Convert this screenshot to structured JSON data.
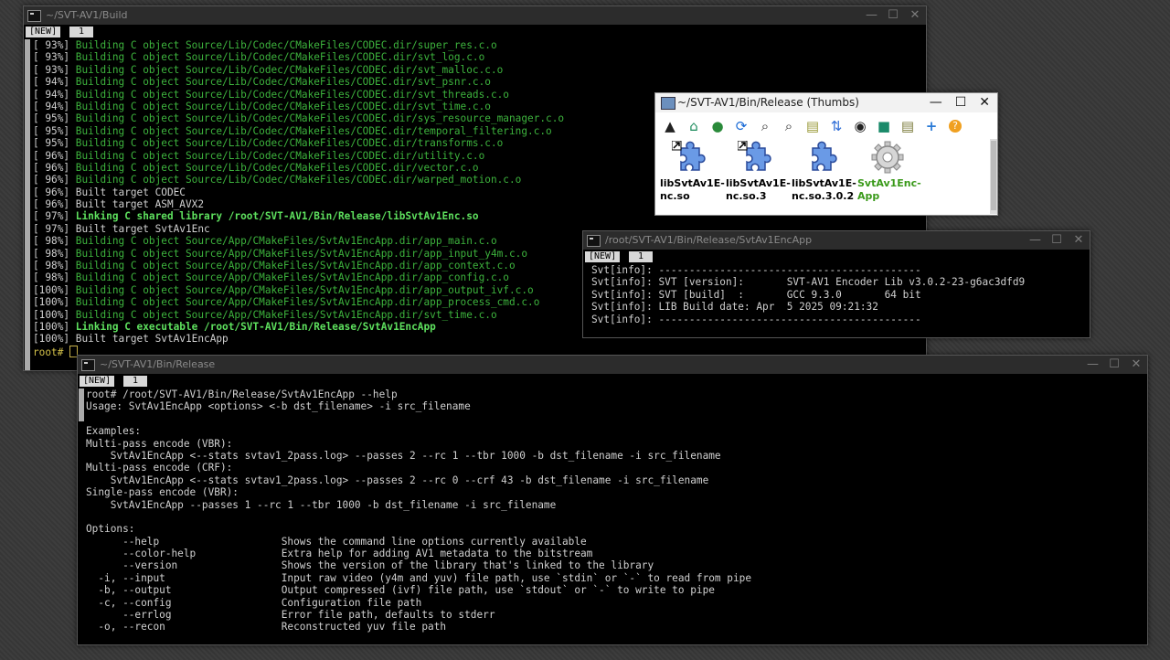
{
  "build_window": {
    "title": "~/SVT-AV1/Build",
    "tabs": [
      "[NEW]",
      "1"
    ],
    "lines": [
      {
        "prefix": "[ 93%] ",
        "text": "Building C object Source/Lib/Codec/CMakeFiles/CODEC.dir/super_res.c.o",
        "style": "g"
      },
      {
        "prefix": "[ 93%] ",
        "text": "Building C object Source/Lib/Codec/CMakeFiles/CODEC.dir/svt_log.c.o",
        "style": "g"
      },
      {
        "prefix": "[ 93%] ",
        "text": "Building C object Source/Lib/Codec/CMakeFiles/CODEC.dir/svt_malloc.c.o",
        "style": "g"
      },
      {
        "prefix": "[ 94%] ",
        "text": "Building C object Source/Lib/Codec/CMakeFiles/CODEC.dir/svt_psnr.c.o",
        "style": "g"
      },
      {
        "prefix": "[ 94%] ",
        "text": "Building C object Source/Lib/Codec/CMakeFiles/CODEC.dir/svt_threads.c.o",
        "style": "g"
      },
      {
        "prefix": "[ 94%] ",
        "text": "Building C object Source/Lib/Codec/CMakeFiles/CODEC.dir/svt_time.c.o",
        "style": "g"
      },
      {
        "prefix": "[ 95%] ",
        "text": "Building C object Source/Lib/Codec/CMakeFiles/CODEC.dir/sys_resource_manager.c.o",
        "style": "g"
      },
      {
        "prefix": "[ 95%] ",
        "text": "Building C object Source/Lib/Codec/CMakeFiles/CODEC.dir/temporal_filtering.c.o",
        "style": "g"
      },
      {
        "prefix": "[ 95%] ",
        "text": "Building C object Source/Lib/Codec/CMakeFiles/CODEC.dir/transforms.c.o",
        "style": "g"
      },
      {
        "prefix": "[ 96%] ",
        "text": "Building C object Source/Lib/Codec/CMakeFiles/CODEC.dir/utility.c.o",
        "style": "g"
      },
      {
        "prefix": "[ 96%] ",
        "text": "Building C object Source/Lib/Codec/CMakeFiles/CODEC.dir/vector.c.o",
        "style": "g"
      },
      {
        "prefix": "[ 96%] ",
        "text": "Building C object Source/Lib/Codec/CMakeFiles/CODEC.dir/warped_motion.c.o",
        "style": "g"
      },
      {
        "prefix": "[ 96%] ",
        "text": "Built target CODEC",
        "style": "w"
      },
      {
        "prefix": "[ 96%] ",
        "text": "Built target ASM_AVX2",
        "style": "w"
      },
      {
        "prefix": "[ 97%] ",
        "text": "Linking C shared library /root/SVT-AV1/Bin/Release/libSvtAv1Enc.so",
        "style": "gb"
      },
      {
        "prefix": "[ 97%] ",
        "text": "Built target SvtAv1Enc",
        "style": "w"
      },
      {
        "prefix": "[ 98%] ",
        "text": "Building C object Source/App/CMakeFiles/SvtAv1EncApp.dir/app_main.c.o",
        "style": "g"
      },
      {
        "prefix": "[ 98%] ",
        "text": "Building C object Source/App/CMakeFiles/SvtAv1EncApp.dir/app_input_y4m.c.o",
        "style": "g"
      },
      {
        "prefix": "[ 98%] ",
        "text": "Building C object Source/App/CMakeFiles/SvtAv1EncApp.dir/app_context.c.o",
        "style": "g"
      },
      {
        "prefix": "[ 98%] ",
        "text": "Building C object Source/App/CMakeFiles/SvtAv1EncApp.dir/app_config.c.o",
        "style": "g"
      },
      {
        "prefix": "[100%] ",
        "text": "Building C object Source/App/CMakeFiles/SvtAv1EncApp.dir/app_output_ivf.c.o",
        "style": "g"
      },
      {
        "prefix": "[100%] ",
        "text": "Building C object Source/App/CMakeFiles/SvtAv1EncApp.dir/app_process_cmd.c.o",
        "style": "g"
      },
      {
        "prefix": "[100%] ",
        "text": "Building C object Source/App/CMakeFiles/SvtAv1EncApp.dir/svt_time.c.o",
        "style": "g"
      },
      {
        "prefix": "[100%] ",
        "text": "Linking C executable /root/SVT-AV1/Bin/Release/SvtAv1EncApp",
        "style": "gb"
      },
      {
        "prefix": "[100%] ",
        "text": "Built target SvtAv1EncApp",
        "style": "w"
      }
    ],
    "prompt": "root# "
  },
  "thumbs_window": {
    "title": "~/SVT-AV1/Bin/Release (Thumbs)",
    "toolbar_icons": [
      "up-arrow-icon",
      "home-icon",
      "back-icon",
      "refresh-icon",
      "zoom-in-icon",
      "zoom-out-icon",
      "details-icon",
      "sort-icon",
      "eye-icon",
      "folder-icon",
      "list-icon",
      "plus-icon",
      "help-icon"
    ],
    "files": [
      {
        "name": "libSvtAv1E-\nnc.so",
        "kind": "puzzle-link"
      },
      {
        "name": "libSvtAv1E-\nnc.so.3",
        "kind": "puzzle-link"
      },
      {
        "name": "libSvtAv1E-\nnc.so.3.0.2",
        "kind": "puzzle"
      },
      {
        "name": "SvtAv1Enc-\nApp",
        "kind": "gear"
      }
    ]
  },
  "info_window": {
    "title": "/root/SVT-AV1/Bin/Release/SvtAv1EncApp",
    "tabs": [
      "[NEW]",
      "1"
    ],
    "lines": [
      "Svt[info]: -------------------------------------------",
      "Svt[info]: SVT [version]:       SVT-AV1 Encoder Lib v3.0.2-23-g6ac3dfd9",
      "Svt[info]: SVT [build]  :       GCC 9.3.0       64 bit",
      "Svt[info]: LIB Build date: Apr  5 2025 09:21:32",
      "Svt[info]: -------------------------------------------"
    ]
  },
  "help_window": {
    "title": "~/SVT-AV1/Bin/Release",
    "tabs": [
      "[NEW]",
      "1"
    ],
    "lines": [
      "root# /root/SVT-AV1/Bin/Release/SvtAv1EncApp --help",
      "Usage: SvtAv1EncApp <options> <-b dst_filename> -i src_filename",
      "",
      "Examples:",
      "Multi-pass encode (VBR):",
      "    SvtAv1EncApp <--stats svtav1_2pass.log> --passes 2 --rc 1 --tbr 1000 -b dst_filename -i src_filename",
      "Multi-pass encode (CRF):",
      "    SvtAv1EncApp <--stats svtav1_2pass.log> --passes 2 --rc 0 --crf 43 -b dst_filename -i src_filename",
      "Single-pass encode (VBR):",
      "    SvtAv1EncApp --passes 1 --rc 1 --tbr 1000 -b dst_filename -i src_filename",
      "",
      "Options:",
      "      --help                    Shows the command line options currently available",
      "      --color-help              Extra help for adding AV1 metadata to the bitstream",
      "      --version                 Shows the version of the library that's linked to the library",
      "  -i, --input                   Input raw video (y4m and yuv) file path, use `stdin` or `-` to read from pipe",
      "  -b, --output                  Output compressed (ivf) file path, use `stdout` or `-` to write to pipe",
      "  -c, --config                  Configuration file path",
      "      --errlog                  Error file path, defaults to stderr",
      "  -o, --recon                   Reconstructed yuv file path"
    ]
  },
  "window_controls": {
    "minimize": "—",
    "maximize": "☐",
    "close": "✕"
  },
  "colors": {
    "green": "#3db33d",
    "bold_green": "#5ee05e",
    "prompt_yellow": "#d6c34a"
  }
}
